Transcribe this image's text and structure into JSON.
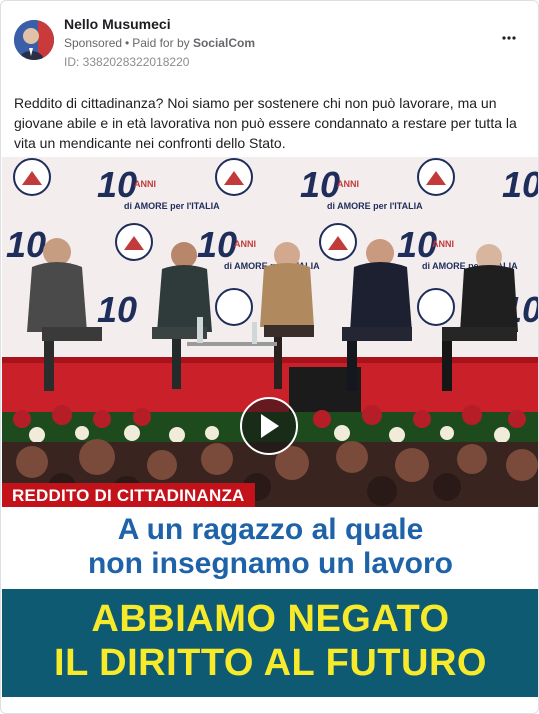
{
  "post": {
    "author": "Nello Musumeci",
    "sponsored": "Sponsored",
    "paid_for_prefix": "Paid for by",
    "payer": "SocialCom",
    "ad_id": "ID: 3382028322018220",
    "more_icon": "more-options-icon",
    "text": "Reddito di cittadinanza? Noi siamo per sostenere chi non può lavorare, ma un giovane abile e in età lavorativa non può essere condannato a restare per tutta la vita un mendicante nei confronti dello Stato."
  },
  "media": {
    "backdrop_logo_title": "10",
    "backdrop_logo_word": "ANNI",
    "backdrop_logo_subtitle": "di AMORE per l'ITALIA",
    "backdrop_party": "FRATELLI d'ITALIA",
    "caption": "REDDITO DI CITTADINANZA",
    "headline_line1": "A un ragazzo al quale",
    "headline_line2": "non insegnamo un lavoro",
    "slogan_line1": "ABBIAMO NEGATO",
    "slogan_line2": "IL DIRITTO AL FUTURO",
    "play_icon": "play-icon"
  },
  "colors": {
    "caption_red": "#c4121b",
    "headline_blue": "#1e63a8",
    "slogan_bg": "#0f5a73",
    "slogan_yellow": "#f7ea2a"
  }
}
